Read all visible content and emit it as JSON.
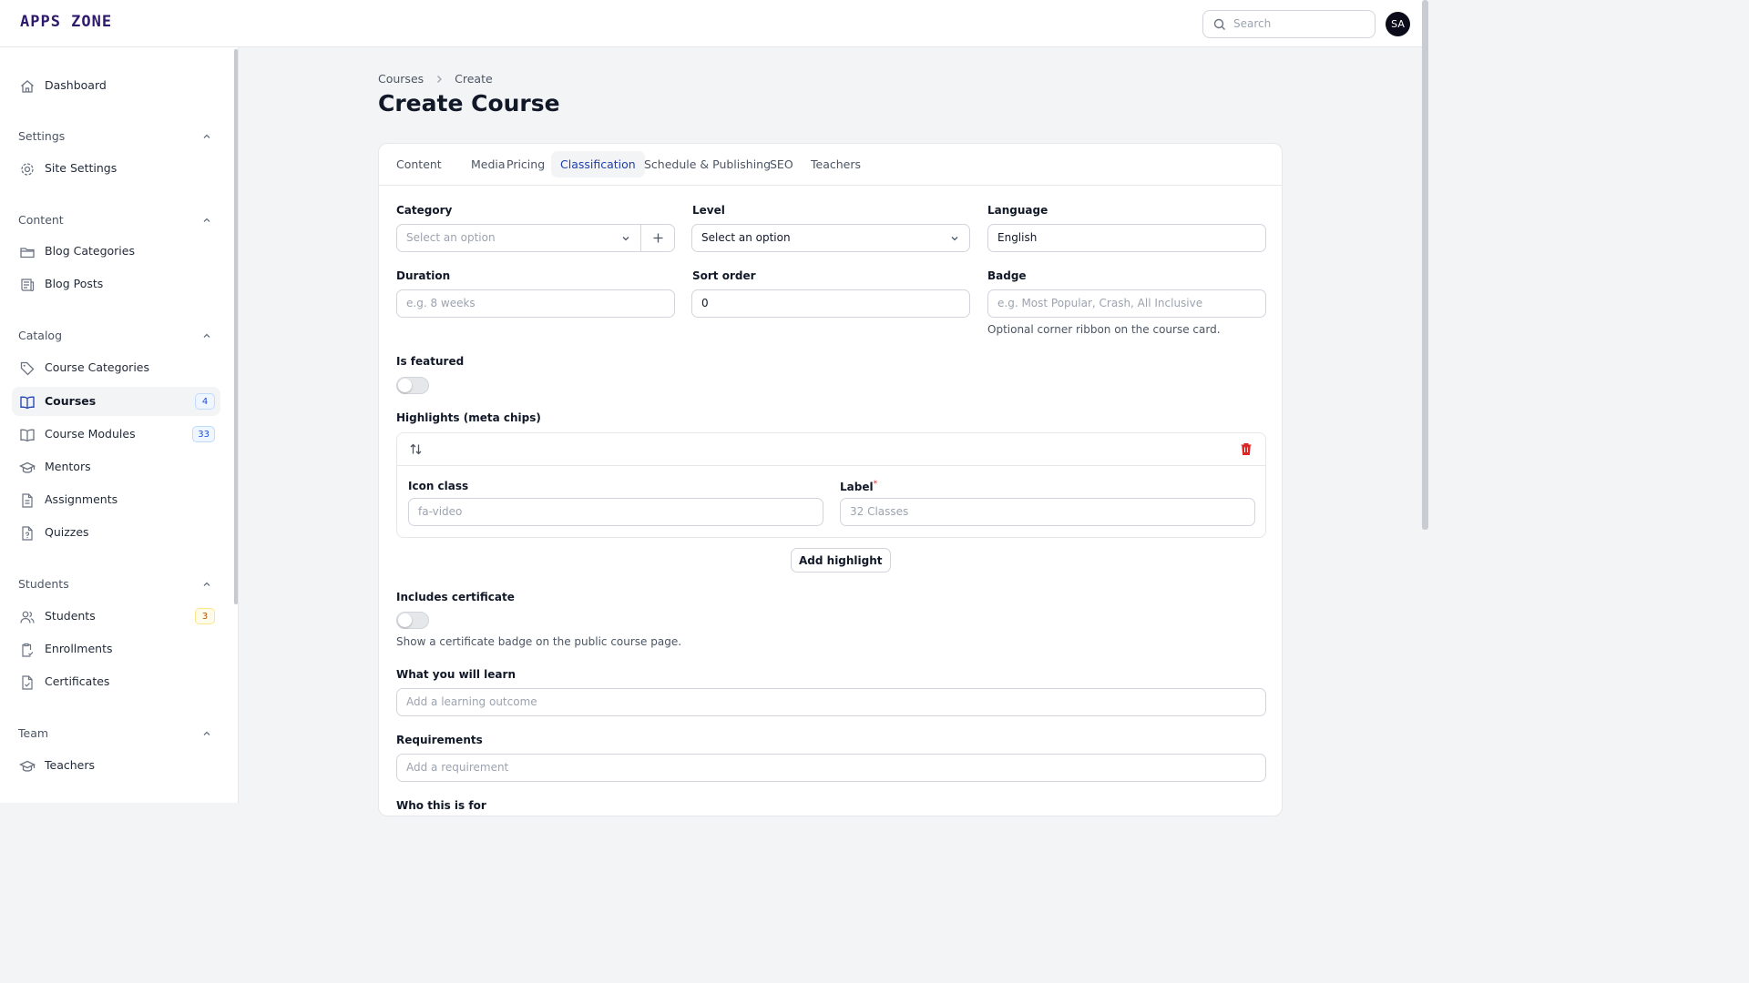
{
  "app": {
    "logo": "APPS ZONE"
  },
  "topbar": {
    "search_placeholder": "Search",
    "avatar_initials": "SA"
  },
  "sidebar": {
    "dashboard": "Dashboard",
    "groups": {
      "settings": "Settings",
      "content": "Content",
      "catalog": "Catalog",
      "students": "Students",
      "team": "Team"
    },
    "items": {
      "site_settings": "Site Settings",
      "blog_categories": "Blog Categories",
      "blog_posts": "Blog Posts",
      "course_categories": "Course Categories",
      "courses": "Courses",
      "courses_count": "4",
      "course_modules": "Course Modules",
      "course_modules_count": "33",
      "mentors": "Mentors",
      "assignments": "Assignments",
      "quizzes": "Quizzes",
      "students": "Students",
      "students_count": "3",
      "enrollments": "Enrollments",
      "certificates": "Certificates",
      "teachers": "Teachers"
    }
  },
  "breadcrumb": {
    "parent": "Courses",
    "current": "Create"
  },
  "page": {
    "title": "Create Course"
  },
  "tabs": {
    "content": "Content",
    "media": "Media",
    "pricing": "Pricing",
    "classification": "Classification",
    "schedule": "Schedule & Publishing",
    "seo": "SEO",
    "teachers": "Teachers",
    "active": "Classification"
  },
  "form": {
    "category": {
      "label": "Category",
      "placeholder": "Select an option"
    },
    "level": {
      "label": "Level",
      "value": "Select an option"
    },
    "language": {
      "label": "Language",
      "value": "English"
    },
    "duration": {
      "label": "Duration",
      "placeholder": "e.g. 8 weeks"
    },
    "sort_order": {
      "label": "Sort order",
      "value": "0"
    },
    "badge": {
      "label": "Badge",
      "placeholder": "e.g. Most Popular, Crash, All Inclusive",
      "help": "Optional corner ribbon on the course card."
    },
    "is_featured": {
      "label": "Is featured",
      "on": false
    },
    "highlights": {
      "label": "Highlights (meta chips)",
      "icon_class": {
        "label": "Icon class",
        "placeholder": "fa-video"
      },
      "item_label": {
        "label": "Label",
        "required_mark": "*",
        "placeholder": "32 Classes"
      },
      "add_button": "Add highlight"
    },
    "includes_certificate": {
      "label": "Includes certificate",
      "on": false,
      "help": "Show a certificate badge on the public course page."
    },
    "learn": {
      "label": "What you will learn",
      "placeholder": "Add a learning outcome"
    },
    "requirements": {
      "label": "Requirements",
      "placeholder": "Add a requirement"
    },
    "cutoff_label": "Who this is for"
  },
  "colors": {
    "accent": "#1e40af",
    "danger": "#dc2626",
    "logo": "#2d1a6b"
  }
}
